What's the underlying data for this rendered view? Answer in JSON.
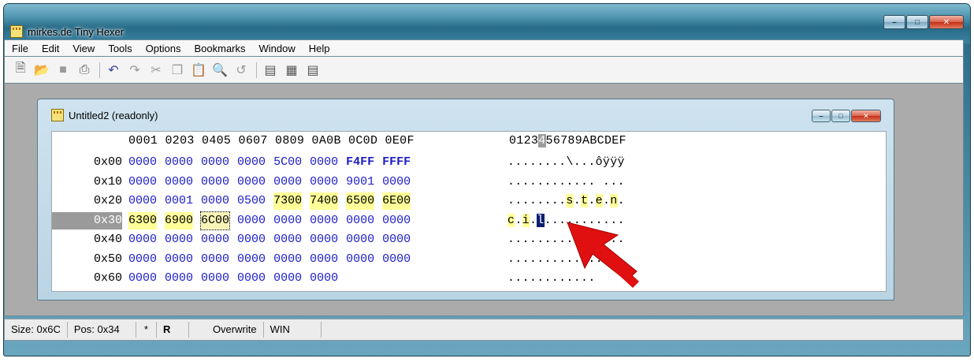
{
  "app": {
    "title": "mirkes.de Tiny Hexer",
    "icon": "hex-app-icon",
    "caption_buttons": [
      "minimize",
      "maximize",
      "close"
    ]
  },
  "menu": [
    "File",
    "Edit",
    "View",
    "Tools",
    "Options",
    "Bookmarks",
    "Window",
    "Help"
  ],
  "toolbar": {
    "icons": [
      "new-file-icon",
      "open-folder-icon",
      "save-icon",
      "print-icon",
      "undo-icon",
      "redo-icon",
      "cut-icon",
      "copy-icon",
      "paste-icon",
      "find-icon",
      "replace-icon",
      "view-hex-icon",
      "view-text-icon",
      "view-table-icon"
    ]
  },
  "document": {
    "title": "Untitled2 (readonly)",
    "header_hex": "0001 0203 0405 0607 0809 0A0B 0C0D 0E0F",
    "header_ascii_before": "0123",
    "header_ascii_caret": "4",
    "header_ascii_after": "56789ABCDEF",
    "rows": [
      {
        "addr": "0x00",
        "words": [
          "0000",
          "0000",
          "0000",
          "0000",
          "5C00",
          "0000",
          "F4FF",
          "FFFF"
        ],
        "ascii": "........\\...ôÿÿÿ"
      },
      {
        "addr": "0x10",
        "words": [
          "0000",
          "0000",
          "0000",
          "0000",
          "0000",
          "0000",
          "9001",
          "0000"
        ],
        "ascii": "............ ..."
      },
      {
        "addr": "0x20",
        "words": [
          "0000",
          "0001",
          "0000",
          "0500",
          "7300",
          "7400",
          "6500",
          "6E00"
        ],
        "ascii_a": "........",
        "ascii_chars": [
          "s",
          "t",
          "e",
          "n"
        ]
      },
      {
        "addr": "0x30",
        "words": [
          "6300",
          "6900",
          "6C00",
          "0000",
          "0000",
          "0000",
          "0000",
          "0000"
        ],
        "ascii_chars": [
          "c",
          "i",
          "l"
        ],
        "ascii_tail": "..........."
      },
      {
        "addr": "0x40",
        "words": [
          "0000",
          "0000",
          "0000",
          "0000",
          "0000",
          "0000",
          "0000",
          "0000"
        ],
        "ascii": "................"
      },
      {
        "addr": "0x50",
        "words": [
          "0000",
          "0000",
          "0000",
          "0000",
          "0000",
          "0000",
          "0000",
          "0000"
        ],
        "ascii": "................"
      },
      {
        "addr": "0x60",
        "words": [
          "0000",
          "0000",
          "0000",
          "0000",
          "0000",
          "0000"
        ],
        "ascii": "............"
      }
    ]
  },
  "status": {
    "size": "Size: 0x6C",
    "pos": "Pos: 0x34",
    "modified": "*",
    "mode_r": "R",
    "overwrite": "Overwrite",
    "charset": "WIN"
  },
  "colors": {
    "highlight": "#ffff99",
    "hex_text": "#1c1cc8",
    "cursor": "#0a1e6e",
    "arrow": "#e01010"
  }
}
